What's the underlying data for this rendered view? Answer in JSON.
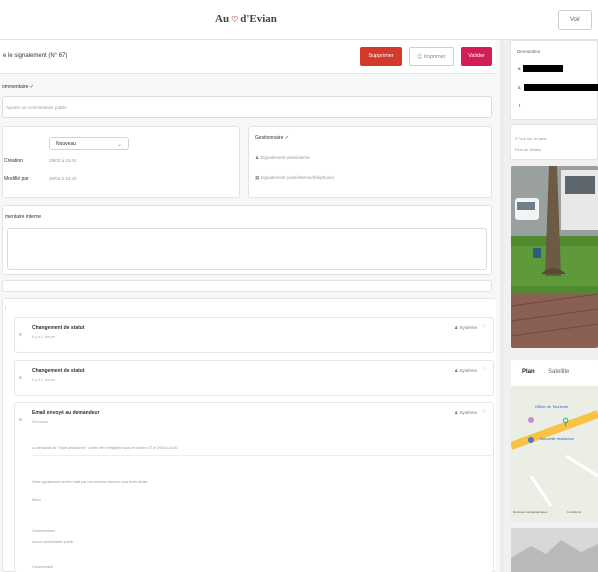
{
  "app": {
    "brand_left": "Au",
    "brand_right": "d'Evian",
    "top_button": "Voir"
  },
  "header": {
    "title": "e le signalement (N° 67)",
    "delete": "Supprimer",
    "print": "Imprimer",
    "validate": "Valider"
  },
  "sections": {
    "comments_title": "ommentaire ✓",
    "comments_placeholder": "Ajouter un commentaire public",
    "status_value": "Nouveau",
    "created_label": "Création",
    "created_value": "29/03 à 15:42",
    "modified_label": "Modifié par",
    "modified_value": "29/03 à 15:42",
    "service_title": "Gestionnaire ✓",
    "service_line1": "Signalement web/interne",
    "service_line2": "Signalement (web/interne/téléphone)",
    "internal_title": "mentaire interne"
  },
  "history": [
    {
      "title": "Changement de statut",
      "sub": "Il y a 1 heure",
      "author": "Système"
    },
    {
      "title": "Changement de statut",
      "sub": "Il y a 1 heure",
      "author": "Système"
    },
    {
      "title": "Email envoyé au demandeur",
      "sub": "Nouveau",
      "author": "Système"
    }
  ],
  "email_lines": [
    "La demande de  \"Objet abandonné \" a bien été enregistrée sous le numéro 67 le 29/03 à 15:42",
    "Votre signalement va être traité par nos services dans les plus brefs délais.",
    "Merci",
    "Commentaires",
    "Aucun commentaire public",
    "Commentaire"
  ],
  "right": {
    "requester_title": "Demandeur",
    "address_line1": "Voir sur la carte",
    "address_line2": "Plus de détails",
    "map_tab_plan": "Plan",
    "map_tab_sat": "Satellite",
    "map_label1": "Office de Tourisme",
    "map_label2": "Nouvelle résidence",
    "map_footer": "Données cartographiques",
    "map_footer2": "Conditions"
  }
}
